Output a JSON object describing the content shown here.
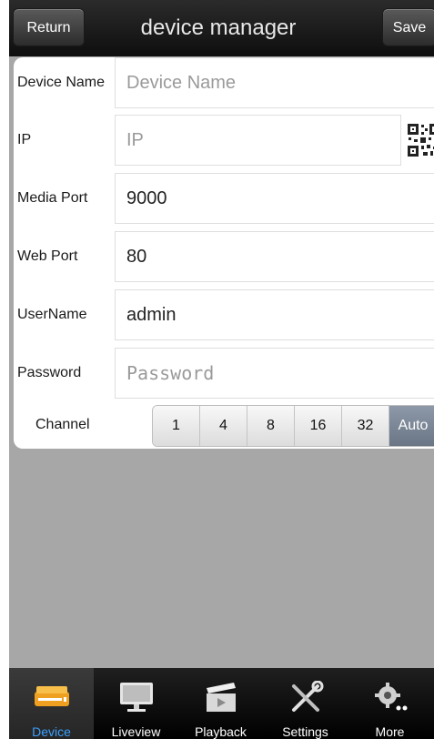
{
  "header": {
    "return_label": "Return",
    "title": "device manager",
    "save_label": "Save"
  },
  "form": {
    "device_name": {
      "label": "Device Name",
      "value": "",
      "placeholder": "Device Name"
    },
    "ip": {
      "label": "IP",
      "value": "",
      "placeholder": "IP"
    },
    "media_port": {
      "label": "Media Port",
      "value": "9000"
    },
    "web_port": {
      "label": "Web Port",
      "value": "80"
    },
    "username": {
      "label": "UserName",
      "value": "admin"
    },
    "password": {
      "label": "Password",
      "value": "",
      "placeholder": "Password"
    },
    "channel": {
      "label": "Channel",
      "options": [
        "1",
        "4",
        "8",
        "16",
        "32",
        "Auto"
      ],
      "selected": "Auto"
    }
  },
  "tabs": [
    {
      "label": "Device",
      "icon": "device-icon",
      "active": true
    },
    {
      "label": "Liveview",
      "icon": "monitor-icon",
      "active": false
    },
    {
      "label": "Playback",
      "icon": "clapperboard-icon",
      "active": false
    },
    {
      "label": "Settings",
      "icon": "tools-icon",
      "active": false
    },
    {
      "label": "More",
      "icon": "gear-icon",
      "active": false
    }
  ],
  "colors": {
    "active_tab_text": "#3aa0ff",
    "header_bg": "#1a1a1a",
    "content_bg": "#a7a7a7",
    "selected_segment": "#7a8595"
  }
}
